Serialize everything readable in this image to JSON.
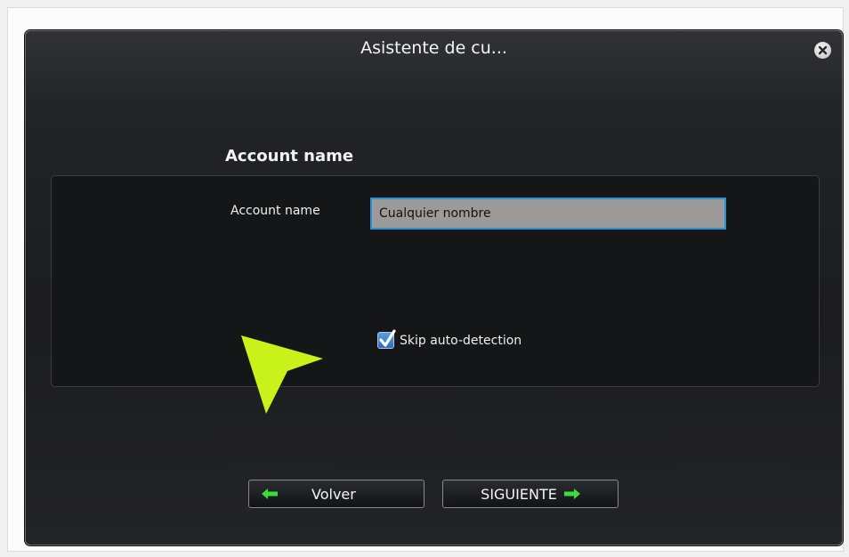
{
  "window": {
    "title": "Asistente de cu..."
  },
  "section": {
    "heading": "Account name"
  },
  "form": {
    "account_name_label": "Account name",
    "account_name_value": "Cualquier nombre",
    "skip_autodetect_label": "Skip auto-detection",
    "skip_autodetect_checked": true
  },
  "buttons": {
    "back_label": "Volver",
    "next_label": "SIGUIENTE"
  },
  "colors": {
    "dialog_bg": "#1b1c1f",
    "accent_green": "#3ddc3d",
    "pointer_arrow": "#c8f21a",
    "input_border": "#2d8fd6",
    "checkbox_blue": "#2f6db7"
  },
  "icons": {
    "close": "close-icon",
    "back": "arrow-left-icon",
    "next": "arrow-right-icon",
    "check": "checkmark-icon",
    "pointer": "pointer-arrow-icon"
  }
}
